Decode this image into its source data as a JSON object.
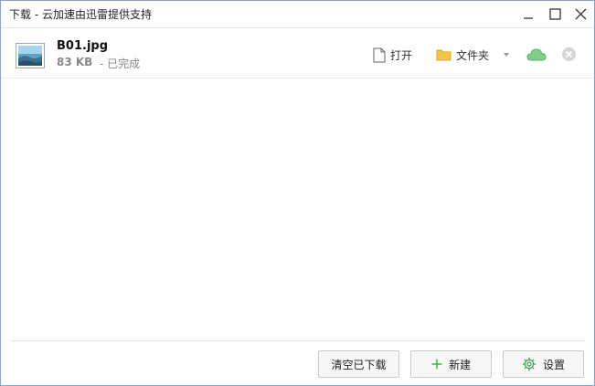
{
  "window": {
    "title": "下载 - 云加速由迅雷提供支持",
    "controls": [
      "minimize-icon",
      "maximize-icon",
      "close-icon"
    ]
  },
  "downloads": [
    {
      "file_name": "B01.jpg",
      "file_size": "83 KB",
      "status": "- 已完成",
      "icon": "image-file-icon",
      "actions": {
        "open_label": "打开",
        "folder_label": "文件夹",
        "cloud_icon": "cloud-icon",
        "remove_icon": "remove-icon"
      }
    }
  ],
  "footer": {
    "clear_label": "清空已下载",
    "new_label": "新建",
    "settings_label": "设置"
  },
  "colors": {
    "accent_green": "#6cc07a",
    "folder_yellow": "#f5c543",
    "border": "#c9c9c9"
  }
}
